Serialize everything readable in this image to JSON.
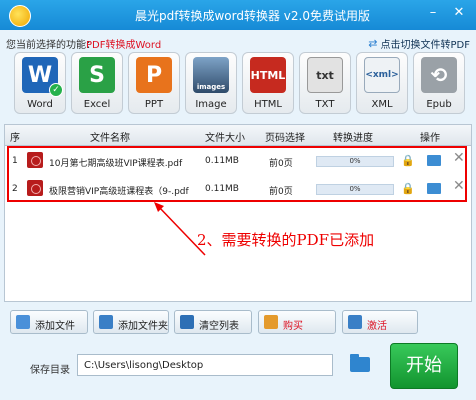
{
  "window": {
    "title": "晨光pdf转换成word转换器 v2.0免费试用版",
    "min_btn": "–",
    "close_btn": "✕"
  },
  "info": {
    "func_label": "您当前选择的功能：",
    "func_value": "PDF转换成Word",
    "switch_label": "点击切换文件转PDF"
  },
  "formats": [
    {
      "label": "Word",
      "glyph": "W",
      "color": "#1f66b8"
    },
    {
      "label": "Excel",
      "glyph": "S",
      "color": "#2aa146"
    },
    {
      "label": "PPT",
      "glyph": "P",
      "color": "#e8731c"
    },
    {
      "label": "Image",
      "glyph": "images",
      "color": "#3d5a78"
    },
    {
      "label": "HTML",
      "glyph": "HTML",
      "color": "#c62a1f"
    },
    {
      "label": "TXT",
      "glyph": "txt",
      "color": "#dedede"
    },
    {
      "label": "XML",
      "glyph": "<xml>",
      "color": "#e9eef2"
    },
    {
      "label": "Epub",
      "glyph": "⟲",
      "color": "#9aa1a7"
    }
  ],
  "table": {
    "headers": [
      "序",
      "文件名称",
      "文件大小",
      "页码选择",
      "转换进度",
      "操作"
    ],
    "rows": [
      {
        "index": "1",
        "name": "10月第七期高级班VIP课程表.pdf",
        "size": "0.11MB",
        "pages": "前0页",
        "progress": "0%"
      },
      {
        "index": "2",
        "name": "极限营销VIP高级班课程表（9-.pdf",
        "size": "0.11MB",
        "pages": "前0页",
        "progress": "0%"
      }
    ]
  },
  "annotation": "2、需要转换的PDF已添加",
  "buttons": {
    "add_file": "添加文件",
    "add_folder": "添加文件夹",
    "clear_list": "清空列表",
    "buy": "购买",
    "activate": "激活"
  },
  "output": {
    "label": "保存目录",
    "path": "C:\\Users\\lisong\\Desktop"
  },
  "start_label": "开始"
}
